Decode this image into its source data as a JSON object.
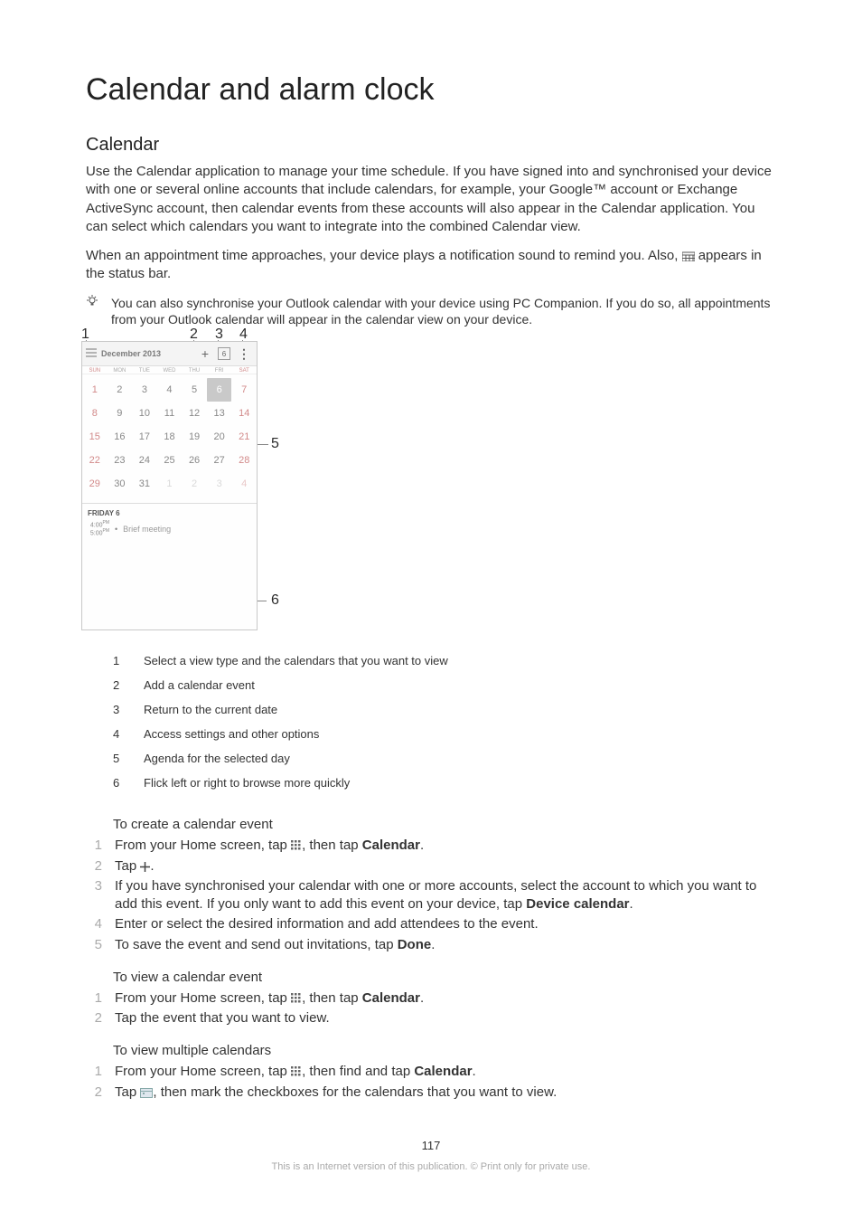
{
  "title": "Calendar and alarm clock",
  "section_title": "Calendar",
  "intro_p1": "Use the Calendar application to manage your time schedule. If you have signed into and synchronised your device with one or several online accounts that include calendars, for example, your Google™ account or Exchange ActiveSync account, then calendar events from these accounts will also appear in the Calendar application. You can select which calendars you want to integrate into the combined Calendar view.",
  "intro_p2_a": "When an appointment time approaches, your device plays a notification sound to remind you. Also, ",
  "intro_p2_b": " appears in the status bar.",
  "tip_text": "You can also synchronise your Outlook calendar with your device using PC Companion. If you do so, all appointments from your Outlook calendar will appear in the calendar view on your device.",
  "shot": {
    "header_title": "December 2013",
    "today_num": "6",
    "dow": [
      "SUN",
      "MON",
      "TUE",
      "WED",
      "THU",
      "FRI",
      "SAT"
    ],
    "cells": [
      {
        "n": "1",
        "we": true
      },
      {
        "n": "2"
      },
      {
        "n": "3"
      },
      {
        "n": "4"
      },
      {
        "n": "5"
      },
      {
        "n": "6",
        "sel": true
      },
      {
        "n": "7",
        "we": true
      },
      {
        "n": "8",
        "we": true
      },
      {
        "n": "9"
      },
      {
        "n": "10"
      },
      {
        "n": "11"
      },
      {
        "n": "12"
      },
      {
        "n": "13"
      },
      {
        "n": "14",
        "we": true
      },
      {
        "n": "15",
        "we": true
      },
      {
        "n": "16"
      },
      {
        "n": "17"
      },
      {
        "n": "18"
      },
      {
        "n": "19"
      },
      {
        "n": "20"
      },
      {
        "n": "21",
        "we": true
      },
      {
        "n": "22",
        "we": true
      },
      {
        "n": "23"
      },
      {
        "n": "24"
      },
      {
        "n": "25"
      },
      {
        "n": "26"
      },
      {
        "n": "27"
      },
      {
        "n": "28",
        "we": true
      },
      {
        "n": "29",
        "we": true
      },
      {
        "n": "30"
      },
      {
        "n": "31"
      },
      {
        "n": "1",
        "ghost": true
      },
      {
        "n": "2",
        "ghost": true
      },
      {
        "n": "3",
        "ghost": true
      },
      {
        "n": "4",
        "ghost": true,
        "we": true
      }
    ],
    "agenda_heading": "FRIDAY 6",
    "agenda_time_a": "4:00",
    "agenda_time_b": "5:00",
    "agenda_suffix": "PM",
    "agenda_title": "Brief meeting"
  },
  "callouts": {
    "c1": "1",
    "c2": "2",
    "c3": "3",
    "c4": "4",
    "c5": "5",
    "c6": "6"
  },
  "legend": [
    {
      "n": "1",
      "t": "Select a view type and the calendars that you want to view"
    },
    {
      "n": "2",
      "t": "Add a calendar event"
    },
    {
      "n": "3",
      "t": "Return to the current date"
    },
    {
      "n": "4",
      "t": "Access settings and other options"
    },
    {
      "n": "5",
      "t": "Agenda for the selected day"
    },
    {
      "n": "6",
      "t": "Flick left or right to browse more quickly"
    }
  ],
  "instr1": {
    "heading": "To create a calendar event",
    "rows": [
      {
        "n": "1",
        "pre": "From your Home screen, tap ",
        "icon": "apps",
        "mid": ", then tap ",
        "bold": "Calendar",
        "post": "."
      },
      {
        "n": "2",
        "pre": "Tap ",
        "icon": "plus",
        "post": "."
      },
      {
        "n": "3",
        "pre": "If you have synchronised your calendar with one or more accounts, select the account to which you want to add this event. If you only want to add this event on your device, tap ",
        "bold": "Device calendar",
        "post": "."
      },
      {
        "n": "4",
        "pre": "Enter or select the desired information and add attendees to the event."
      },
      {
        "n": "5",
        "pre": "To save the event and send out invitations, tap ",
        "bold": "Done",
        "post": "."
      }
    ]
  },
  "instr2": {
    "heading": "To view a calendar event",
    "rows": [
      {
        "n": "1",
        "pre": "From your Home screen, tap ",
        "icon": "apps",
        "mid": ", then tap ",
        "bold": "Calendar",
        "post": "."
      },
      {
        "n": "2",
        "pre": "Tap the event that you want to view."
      }
    ]
  },
  "instr3": {
    "heading": "To view multiple calendars",
    "rows": [
      {
        "n": "1",
        "pre": "From your Home screen, tap ",
        "icon": "apps",
        "mid": ", then find and tap ",
        "bold": "Calendar",
        "post": "."
      },
      {
        "n": "2",
        "pre": "Tap ",
        "icon": "calmini",
        "mid": ", then mark the checkboxes for the calendars that you want to view."
      }
    ]
  },
  "page_number": "117",
  "footer": "This is an Internet version of this publication. © Print only for private use."
}
